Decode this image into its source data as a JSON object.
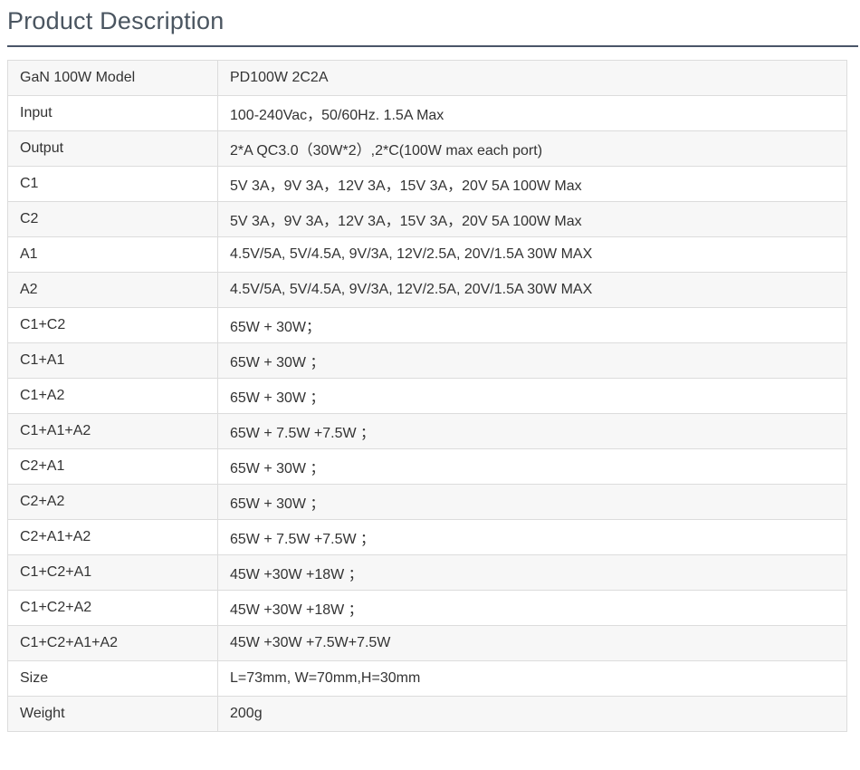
{
  "header": {
    "title": "Product Description"
  },
  "spec_table": {
    "rows": [
      {
        "label": "GaN 100W Model",
        "value": "PD100W 2C2A"
      },
      {
        "label": "Input",
        "value": "100-240Vac，50/60Hz. 1.5A Max"
      },
      {
        "label": "Output",
        "value": "2*A QC3.0（30W*2）,2*C(100W max each port)"
      },
      {
        "label": "C1",
        "value": "5V 3A，9V 3A，12V 3A，15V 3A，20V 5A 100W Max"
      },
      {
        "label": "C2",
        "value": "5V 3A，9V 3A，12V 3A，15V 3A，20V 5A 100W Max"
      },
      {
        "label": "A1",
        "value": "4.5V/5A, 5V/4.5A, 9V/3A, 12V/2.5A, 20V/1.5A 30W MAX"
      },
      {
        "label": "A2",
        "value": "4.5V/5A, 5V/4.5A, 9V/3A, 12V/2.5A, 20V/1.5A 30W MAX"
      },
      {
        "label": "C1+C2",
        "value": "65W + 30W；"
      },
      {
        "label": "C1+A1",
        "value": "65W + 30W ；"
      },
      {
        "label": "C1+A2",
        "value": "65W + 30W ；"
      },
      {
        "label": "C1+A1+A2",
        "value": "65W + 7.5W +7.5W ；"
      },
      {
        "label": "C2+A1",
        "value": "65W + 30W ；"
      },
      {
        "label": "C2+A2",
        "value": "65W + 30W ；"
      },
      {
        "label": "C2+A1+A2",
        "value": "65W + 7.5W +7.5W ；"
      },
      {
        "label": "C1+C2+A1",
        "value": "45W +30W +18W ；"
      },
      {
        "label": "C1+C2+A2",
        "value": "45W +30W +18W ；"
      },
      {
        "label": "C1+C2+A1+A2",
        "value": "45W +30W +7.5W+7.5W"
      },
      {
        "label": "Size",
        "value": "L=73mm, W=70mm,H=30mm"
      },
      {
        "label": "Weight",
        "value": "200g"
      }
    ]
  }
}
